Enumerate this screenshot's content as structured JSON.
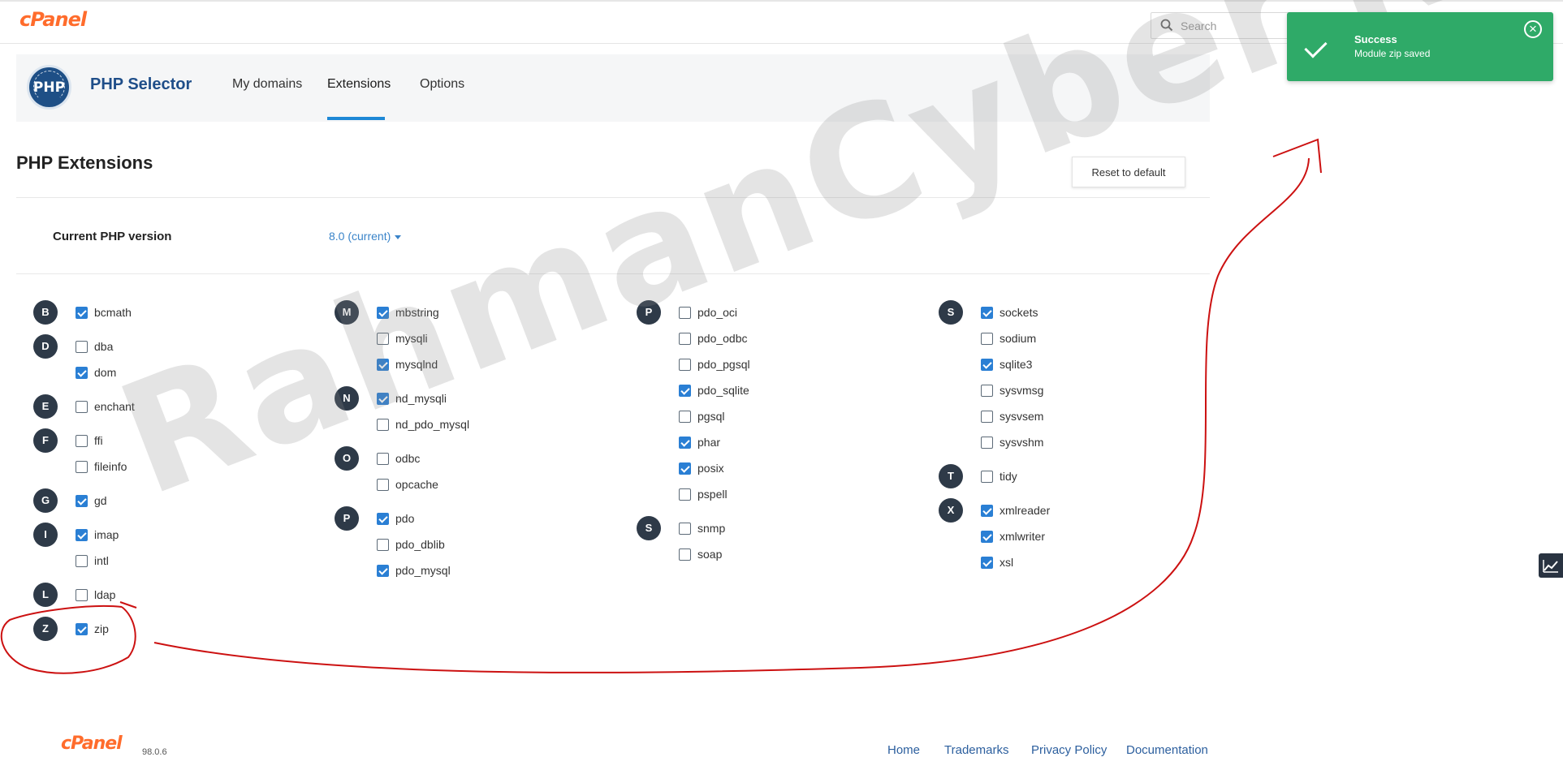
{
  "header": {
    "logo_text": "cPanel",
    "search_placeholder": "Search"
  },
  "app": {
    "title": "PHP Selector",
    "logo_text": "PHP",
    "tabs": [
      {
        "label": "My domains",
        "active": false
      },
      {
        "label": "Extensions",
        "active": true
      },
      {
        "label": "Options",
        "active": false
      }
    ]
  },
  "page": {
    "title": "PHP Extensions",
    "reset_button": "Reset to default",
    "version_label": "Current PHP version",
    "version_value": "8.0 (current)"
  },
  "extensions": [
    [
      {
        "letter": "B",
        "items": [
          {
            "name": "bcmath",
            "checked": true
          }
        ]
      },
      {
        "letter": "D",
        "items": [
          {
            "name": "dba",
            "checked": false
          },
          {
            "name": "dom",
            "checked": true
          }
        ]
      },
      {
        "letter": "E",
        "items": [
          {
            "name": "enchant",
            "checked": false
          }
        ]
      },
      {
        "letter": "F",
        "items": [
          {
            "name": "ffi",
            "checked": false
          },
          {
            "name": "fileinfo",
            "checked": false
          }
        ]
      },
      {
        "letter": "G",
        "items": [
          {
            "name": "gd",
            "checked": true
          }
        ]
      },
      {
        "letter": "I",
        "items": [
          {
            "name": "imap",
            "checked": true
          },
          {
            "name": "intl",
            "checked": false
          }
        ]
      },
      {
        "letter": "L",
        "items": [
          {
            "name": "ldap",
            "checked": false
          }
        ]
      },
      {
        "letter": "Z",
        "items": [
          {
            "name": "zip",
            "checked": true
          }
        ]
      }
    ],
    [
      {
        "letter": "M",
        "items": [
          {
            "name": "mbstring",
            "checked": true
          },
          {
            "name": "mysqli",
            "checked": false
          },
          {
            "name": "mysqlnd",
            "checked": true
          }
        ]
      },
      {
        "letter": "N",
        "items": [
          {
            "name": "nd_mysqli",
            "checked": true
          },
          {
            "name": "nd_pdo_mysql",
            "checked": false
          }
        ]
      },
      {
        "letter": "O",
        "items": [
          {
            "name": "odbc",
            "checked": false
          },
          {
            "name": "opcache",
            "checked": false
          }
        ]
      },
      {
        "letter": "P",
        "items": [
          {
            "name": "pdo",
            "checked": true
          },
          {
            "name": "pdo_dblib",
            "checked": false
          },
          {
            "name": "pdo_mysql",
            "checked": true
          }
        ]
      }
    ],
    [
      {
        "letter": "P",
        "items": [
          {
            "name": "pdo_oci",
            "checked": false
          },
          {
            "name": "pdo_odbc",
            "checked": false
          },
          {
            "name": "pdo_pgsql",
            "checked": false
          },
          {
            "name": "pdo_sqlite",
            "checked": true
          },
          {
            "name": "pgsql",
            "checked": false
          },
          {
            "name": "phar",
            "checked": true
          },
          {
            "name": "posix",
            "checked": true
          },
          {
            "name": "pspell",
            "checked": false
          }
        ]
      },
      {
        "letter": "S",
        "items": [
          {
            "name": "snmp",
            "checked": false
          },
          {
            "name": "soap",
            "checked": false
          }
        ]
      }
    ],
    [
      {
        "letter": "S",
        "items": [
          {
            "name": "sockets",
            "checked": true
          },
          {
            "name": "sodium",
            "checked": false
          },
          {
            "name": "sqlite3",
            "checked": true
          },
          {
            "name": "sysvmsg",
            "checked": false
          },
          {
            "name": "sysvsem",
            "checked": false
          },
          {
            "name": "sysvshm",
            "checked": false
          }
        ]
      },
      {
        "letter": "T",
        "items": [
          {
            "name": "tidy",
            "checked": false
          }
        ]
      },
      {
        "letter": "X",
        "items": [
          {
            "name": "xmlreader",
            "checked": true
          },
          {
            "name": "xmlwriter",
            "checked": true
          },
          {
            "name": "xsl",
            "checked": true
          }
        ]
      }
    ]
  ],
  "toast": {
    "title": "Success",
    "message": "Module zip saved",
    "close_icon": "close-icon",
    "status_icon": "checkmark-icon"
  },
  "watermark": "RahmanCyber.NET",
  "footer": {
    "logo_text": "cPanel",
    "version": "98.0.6",
    "links": [
      "Home",
      "Trademarks",
      "Privacy Policy",
      "Documentation"
    ]
  },
  "colors": {
    "accent": "#2a7fd4",
    "brand_orange": "#ff6c2c",
    "success": "#2faa68",
    "annotation_red": "#cc1111"
  }
}
